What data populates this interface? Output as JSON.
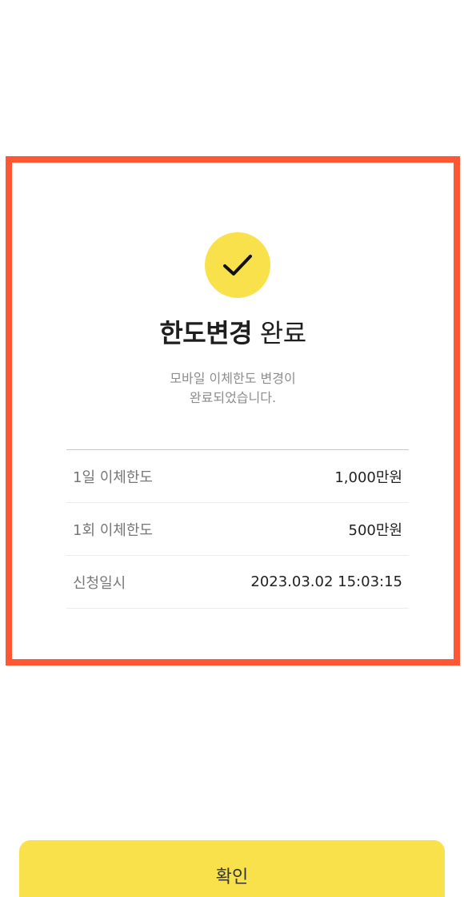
{
  "colors": {
    "accent_yellow": "#f9e14b",
    "highlight_border": "#ff5733",
    "text_primary": "#222222",
    "text_secondary": "#8d8d8d"
  },
  "status": {
    "icon": "check-icon",
    "title_bold": "한도변경",
    "title_normal": " 완료",
    "description_lines": [
      "모바일 이체한도 변경이",
      "완료되었습니다."
    ]
  },
  "details": [
    {
      "label": "1일 이체한도",
      "value": "1,000만원"
    },
    {
      "label": "1회 이체한도",
      "value": "500만원"
    },
    {
      "label": "신청일시",
      "value": "2023.03.02 15:03:15"
    }
  ],
  "footer": {
    "confirm_label": "확인"
  }
}
